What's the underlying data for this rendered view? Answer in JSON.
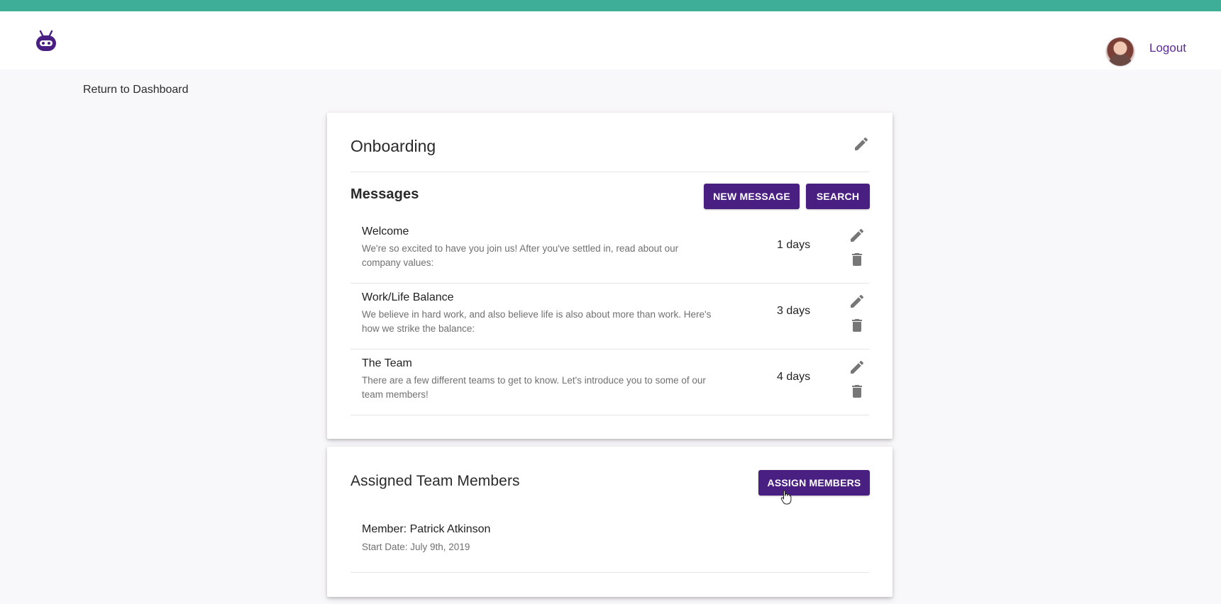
{
  "colors": {
    "brand_stripe": "#3fae98",
    "primary_button": "#4a1f82",
    "logout_link": "#5a2b95",
    "background": "#f8f7f9"
  },
  "header": {
    "logo_icon": "robot-logo-icon",
    "avatar": "user-avatar",
    "logout_label": "Logout"
  },
  "nav": {
    "return_label": "Return to Dashboard"
  },
  "onboarding": {
    "title": "Onboarding",
    "edit_icon": "pencil-icon",
    "messages": {
      "heading": "Messages",
      "new_message_label": "NEW MESSAGE",
      "search_label": "SEARCH",
      "items": [
        {
          "title": "Welcome",
          "body": "We're so excited to have you join us! After you've settled in, read about our company values:",
          "days": "1 days"
        },
        {
          "title": "Work/Life Balance",
          "body": "We believe in hard work, and also believe life is also about more than work. Here's how we strike the balance:",
          "days": "3 days"
        },
        {
          "title": "The Team",
          "body": "There are a few different teams to get to know. Let's introduce you to some of our team members!",
          "days": "4 days"
        }
      ]
    }
  },
  "team": {
    "heading": "Assigned Team Members",
    "assign_label": "ASSIGN MEMBERS",
    "members": [
      {
        "name": "Member: Patrick Atkinson",
        "start": "Start Date: July 9th, 2019"
      }
    ]
  }
}
